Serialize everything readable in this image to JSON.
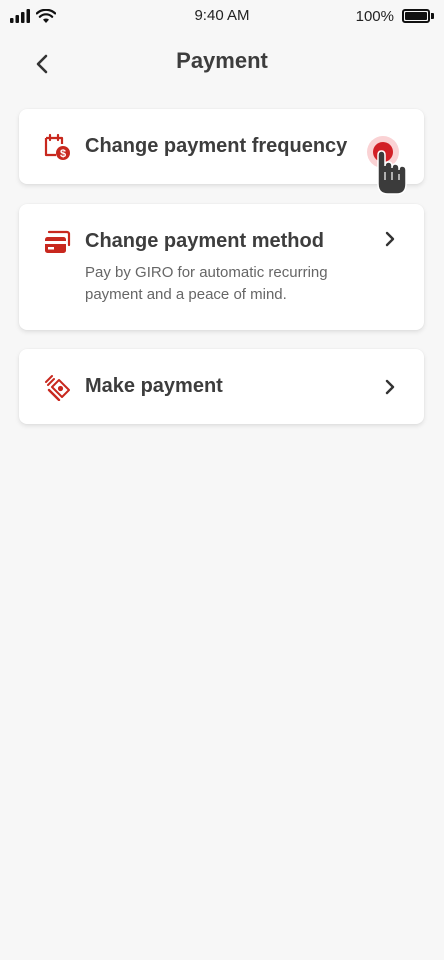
{
  "status_bar": {
    "time": "9:40 AM",
    "battery_percent": "100%"
  },
  "header": {
    "title": "Payment",
    "back_icon": "chevron-left-icon"
  },
  "options": [
    {
      "title": "Change payment frequency",
      "description": "",
      "icon": "calendar-dollar-icon"
    },
    {
      "title": "Change payment method",
      "description": "Pay by GIRO for automatic recurring payment and a peace of mind.",
      "icon": "credit-card-icon"
    },
    {
      "title": "Make payment",
      "description": "",
      "icon": "hand-cash-icon"
    }
  ],
  "colors": {
    "accent": "#c8281e",
    "background": "#f7f7f7",
    "card": "#ffffff",
    "title_text": "#3d3d3d",
    "body_text": "#666666"
  }
}
